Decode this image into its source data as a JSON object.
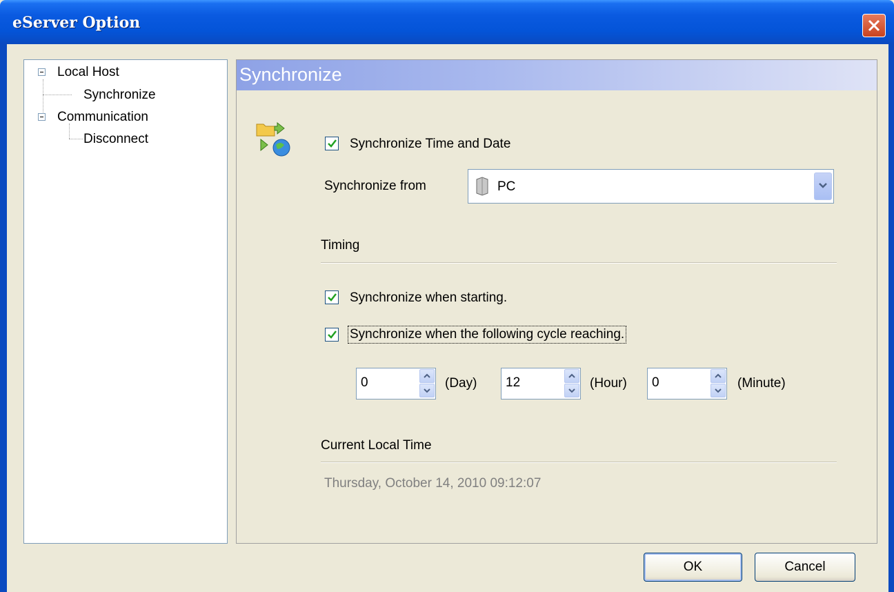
{
  "window": {
    "title": "eServer Option"
  },
  "tree": {
    "items": [
      {
        "label": "Local Host"
      },
      {
        "label": "Synchronize"
      },
      {
        "label": "Communication"
      },
      {
        "label": "Disconnect"
      }
    ]
  },
  "panel": {
    "header": "Synchronize",
    "sync_time_date": {
      "label": "Synchronize Time and Date",
      "checked": true
    },
    "sync_from": {
      "label": "Synchronize from",
      "value": "PC",
      "icon": "computer-icon"
    },
    "timing": {
      "heading": "Timing",
      "when_starting": {
        "label": "Synchronize when starting.",
        "checked": true
      },
      "when_cycle": {
        "label": "Synchronize when the following cycle reaching.",
        "checked": true
      },
      "day": {
        "value": "0",
        "unit": "(Day)"
      },
      "hour": {
        "value": "12",
        "unit": "(Hour)"
      },
      "minute": {
        "value": "0",
        "unit": "(Minute)"
      }
    },
    "current_time": {
      "heading": "Current Local Time",
      "value": "Thursday, October 14, 2010 09:12:07"
    }
  },
  "buttons": {
    "ok": "OK",
    "cancel": "Cancel"
  },
  "colors": {
    "titlebar": "#0454d8",
    "panel_header": "#8ea2e6",
    "close": "#c8431f",
    "check": "#21a121"
  }
}
